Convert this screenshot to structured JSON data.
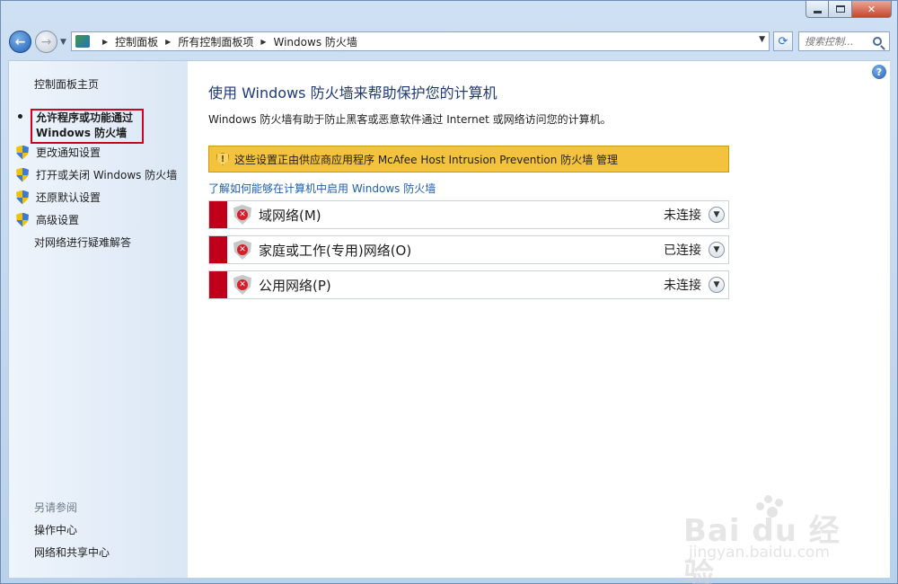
{
  "window": {
    "caption_buttons": {
      "minimize_icon": "minimize-icon",
      "maximize_icon": "maximize-icon",
      "close_glyph": "✕"
    }
  },
  "nav": {
    "back_glyph": "←",
    "forward_glyph": "→",
    "breadcrumbs": [
      "控制面板",
      "所有控制面板项",
      "Windows 防火墙"
    ],
    "search_placeholder": "搜索控制...",
    "refresh_glyph": "⟳"
  },
  "sidebar": {
    "home_link": "控制面板主页",
    "current_item_line1": "允许程序或功能通过",
    "current_item_line2": "Windows 防火墙",
    "items": [
      {
        "label": "更改通知设置",
        "icon": "uac-shield-icon"
      },
      {
        "label": "打开或关闭 Windows 防火墙",
        "icon": "uac-shield-icon"
      },
      {
        "label": "还原默认设置",
        "icon": "uac-shield-icon"
      },
      {
        "label": "高级设置",
        "icon": "uac-shield-icon"
      }
    ],
    "troubleshoot_link": "对网络进行疑难解答",
    "see_also_heading": "另请参阅",
    "related": [
      "操作中心",
      "网络和共享中心"
    ]
  },
  "main": {
    "title": "使用 Windows 防火墙来帮助保护您的计算机",
    "description": "Windows 防火墙有助于防止黑客或恶意软件通过 Internet 或网络访问您的计算机。",
    "warning": "这些设置正由供应商应用程序 McAfee Host Intrusion Prevention 防火墙 管理",
    "learn_link": "了解如何能够在计算机中启用 Windows 防火墙",
    "networks": [
      {
        "name": "域网络(M)",
        "status": "未连接"
      },
      {
        "name": "家庭或工作(专用)网络(O)",
        "status": "已连接"
      },
      {
        "name": "公用网络(P)",
        "status": "未连接"
      }
    ],
    "help_glyph": "?"
  },
  "watermark": {
    "logo": "Bai du 经验",
    "url": "jingyan.baidu.com"
  },
  "colors": {
    "accent_red": "#c0001a",
    "warning_yellow": "#f4c33d",
    "link_blue": "#1f5fa8",
    "title_blue": "#1f3a78"
  }
}
